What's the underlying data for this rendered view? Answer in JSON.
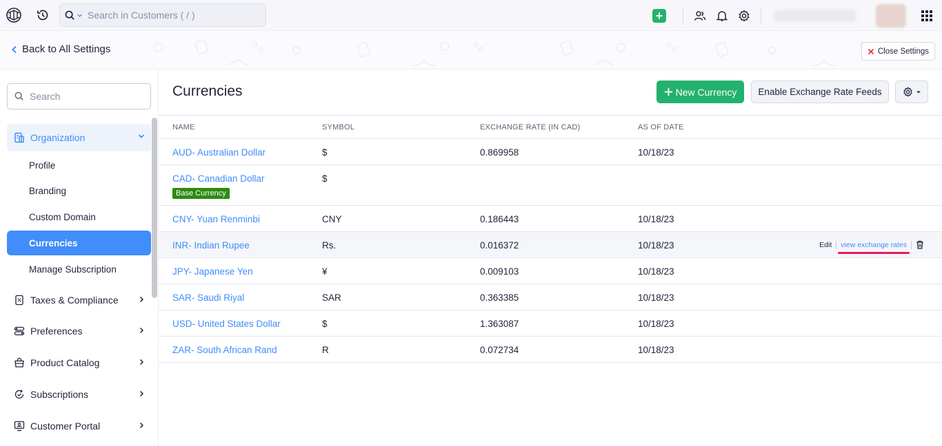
{
  "topbar": {
    "search_placeholder": "Search in Customers ( / )",
    "icons": [
      "app-logo-icon",
      "recent-activity-icon",
      "search-icon",
      "chevron-down-icon",
      "quick-create-icon",
      "people-icon",
      "bell-icon",
      "gear-icon",
      "apps-grid-icon"
    ],
    "add_symbol": "+"
  },
  "header": {
    "back_label": "Back to All Settings",
    "close_label": "Close Settings"
  },
  "sidebar": {
    "search_placeholder": "Search",
    "organization": {
      "label": "Organization",
      "items": [
        {
          "label": "Profile",
          "active": false
        },
        {
          "label": "Branding",
          "active": false
        },
        {
          "label": "Custom Domain",
          "active": false
        },
        {
          "label": "Currencies",
          "active": true
        },
        {
          "label": "Manage Subscription",
          "active": false
        }
      ]
    },
    "groups": [
      {
        "label": "Taxes & Compliance",
        "icon": "tax-icon"
      },
      {
        "label": "Preferences",
        "icon": "preferences-icon"
      },
      {
        "label": "Product Catalog",
        "icon": "product-catalog-icon"
      },
      {
        "label": "Subscriptions",
        "icon": "subscriptions-icon"
      },
      {
        "label": "Customer Portal",
        "icon": "customer-portal-icon"
      }
    ]
  },
  "main": {
    "title": "Currencies",
    "new_button": "New Currency",
    "feeds_button": "Enable Exchange Rate Feeds",
    "columns": [
      "NAME",
      "SYMBOL",
      "EXCHANGE RATE (IN CAD)",
      "AS OF DATE"
    ],
    "rows": [
      {
        "name": "AUD- Australian Dollar",
        "symbol": "$",
        "rate": "0.869958",
        "date": "10/18/23"
      },
      {
        "name": "CAD- Canadian Dollar",
        "symbol": "$",
        "rate": "",
        "date": "",
        "badge": "Base Currency"
      },
      {
        "name": "CNY- Yuan Renminbi",
        "symbol": "CNY",
        "rate": "0.186443",
        "date": "10/18/23"
      },
      {
        "name": "INR- Indian Rupee",
        "symbol": "Rs.",
        "rate": "0.016372",
        "date": "10/18/23"
      },
      {
        "name": "JPY- Japanese Yen",
        "symbol": "¥",
        "rate": "0.009103",
        "date": "10/18/23"
      },
      {
        "name": "SAR- Saudi Riyal",
        "symbol": "SAR",
        "rate": "0.363385",
        "date": "10/18/23"
      },
      {
        "name": "USD- United States Dollar",
        "symbol": "$",
        "rate": "1.363087",
        "date": "10/18/23"
      },
      {
        "name": "ZAR- South African Rand",
        "symbol": "R",
        "rate": "0.072734",
        "date": "10/18/23"
      }
    ],
    "row_actions": {
      "edit": "Edit",
      "view": "view exchange rates"
    }
  },
  "colors": {
    "accent": "#408dfb",
    "green": "#23b26d",
    "badge_green": "#2e8b12",
    "highlight_underline": "#e8195e",
    "close_x": "#e8344e"
  }
}
